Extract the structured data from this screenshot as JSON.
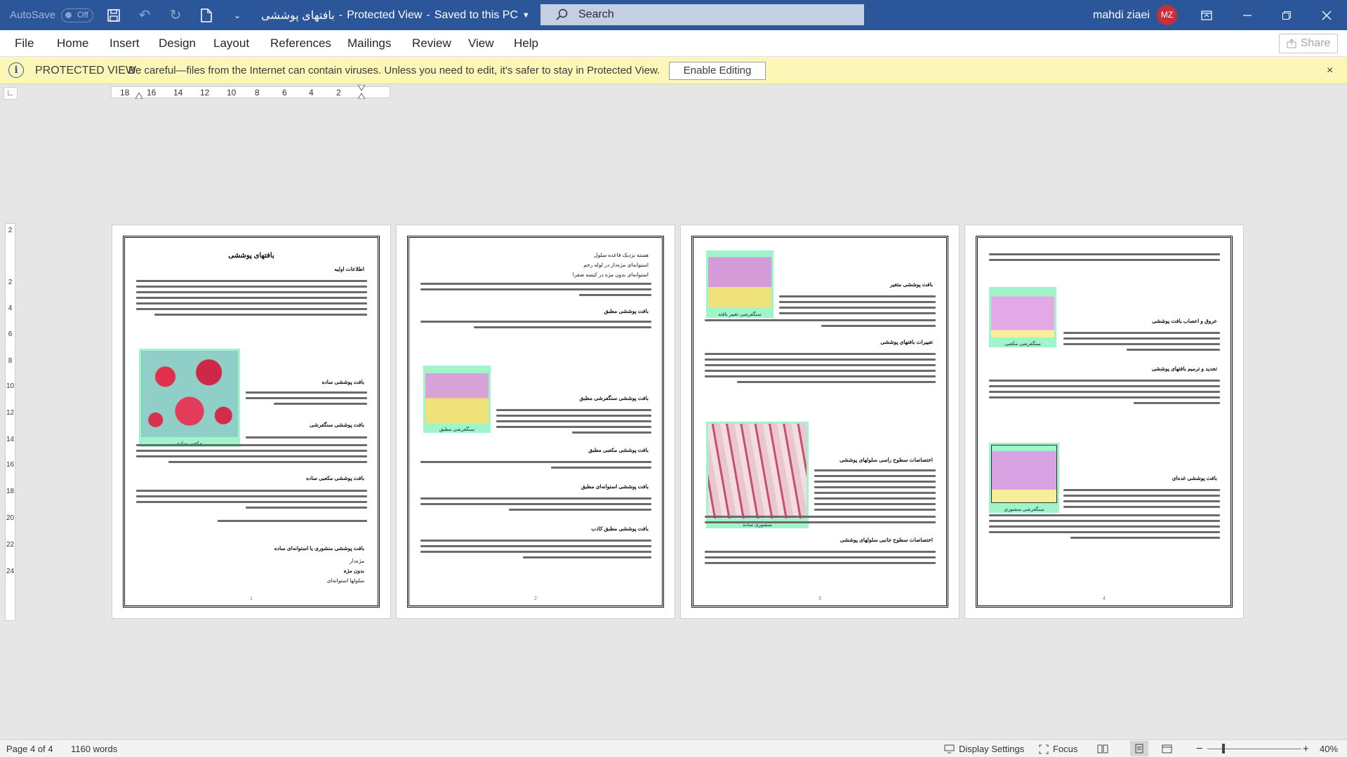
{
  "titlebar": {
    "autosave_label": "AutoSave",
    "autosave_state": "Off",
    "document_name": "بافتهای پوششی",
    "protected_view": "Protected View",
    "save_status": "Saved to this PC",
    "search_placeholder": "Search",
    "user_name": "mahdi ziaei",
    "user_initials": "MZ"
  },
  "menu": {
    "items": [
      "File",
      "Home",
      "Insert",
      "Design",
      "Layout",
      "References",
      "Mailings",
      "Review",
      "View",
      "Help"
    ],
    "share_label": "Share"
  },
  "protected_bar": {
    "title": "PROTECTED VIEW",
    "message": "Be careful—files from the Internet can contain viruses. Unless you need to edit, it's safer to stay in Protected View.",
    "button": "Enable Editing",
    "close": "×"
  },
  "ruler": {
    "horizontal_labels": [
      "18",
      "16",
      "14",
      "12",
      "10",
      "8",
      "6",
      "4",
      "2"
    ],
    "vertical_labels": [
      "2",
      "2",
      "4",
      "6",
      "8",
      "10",
      "12",
      "14",
      "16",
      "18",
      "20",
      "22",
      "24"
    ]
  },
  "pages": [
    {
      "title": "بافتهای پوششی",
      "headings": [
        "اطلاعات اولیه",
        "بافت پوششی ساده",
        "بافت پوششی سنگفرشی",
        "بافت پوششی مکعبی ساده",
        "بافت پوششی منشوری یا استوانه‌ای ساده"
      ],
      "figure_caption": "مکعبی ساده",
      "list": [
        "مژه‌دار",
        "بدون مژه",
        "سلولها استوانه‌ای"
      ],
      "number": "1"
    },
    {
      "intro_lines": [
        "هسته نزدیک قاعده سلول",
        "استوانه‌ای مژه‌دار در لوله رحم",
        "استوانه‌ای بدون مژه در کیسه صفرا"
      ],
      "headings": [
        "بافت پوششی مطبق",
        "بافت پوششی سنگفرشی مطبق",
        "بافت پوششی مکعبی مطبق",
        "بافت پوششی استوانه‌ای مطبق",
        "بافت پوششی مطبق کاذب"
      ],
      "figure_caption": "سنگفرشی مطبق",
      "number": "2"
    },
    {
      "headings": [
        "بافت پوششی متغیر",
        "تغییرات بافتهای پوششی",
        "اختصاصات سطوح راسی سلولهای پوششی",
        "اختصاصات سطوح جانبی سلولهای پوششی"
      ],
      "figure_captions": [
        "سنگفرشی تغییر یافته",
        "منشوری ساده"
      ],
      "number": "3"
    },
    {
      "headings": [
        "عروق و اعصاب بافت پوششی",
        "تجدید و ترمیم بافتهای پوششی",
        "بافت پوششی غده‌ای"
      ],
      "figure_captions": [
        "سنگفرشی مکعبی",
        "سنگفرشی منشوری"
      ],
      "number": "4"
    }
  ],
  "status": {
    "page": "Page 4 of 4",
    "words": "1160 words",
    "display_settings": "Display Settings",
    "focus": "Focus",
    "zoom": "40%"
  }
}
